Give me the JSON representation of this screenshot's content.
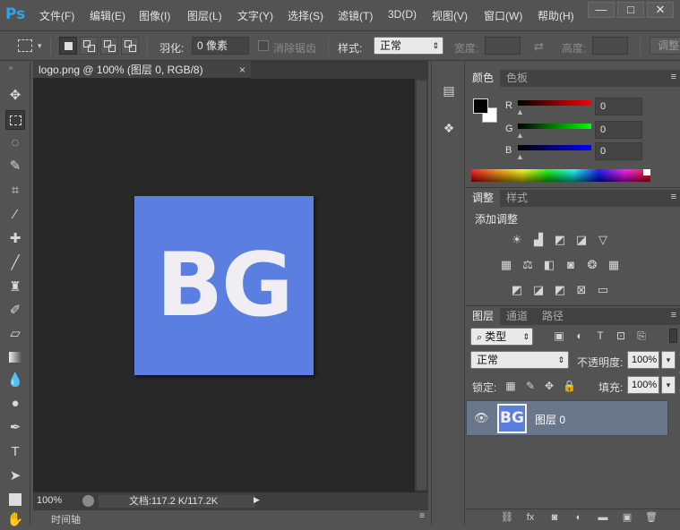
{
  "app": {
    "logo": "Ps"
  },
  "menu": [
    "文件(F)",
    "编辑(E)",
    "图像(I)",
    "图层(L)",
    "文字(Y)",
    "选择(S)",
    "滤镜(T)",
    "3D(D)",
    "视图(V)",
    "窗口(W)",
    "帮助(H)"
  ],
  "window_controls": {
    "minimize": "—",
    "maximize": "□",
    "close": "✕"
  },
  "options": {
    "feather_label": "羽化:",
    "feather_value": "0 像素",
    "antialias_label": "消除锯齿",
    "style_label": "样式:",
    "style_value": "正常",
    "width_label": "宽度:",
    "height_label": "高度:",
    "adjust_button": "调整"
  },
  "document": {
    "tab_title": "logo.png @ 100% (图层 0, RGB/8)",
    "close": "×",
    "artboard_text": "BG",
    "artboard_color": "#5b7fe0",
    "zoom": "100%",
    "doc_size": "文档:117.2 K/117.2K"
  },
  "timeline": {
    "label": "时间轴"
  },
  "color_panel": {
    "tabs": [
      "颜色",
      "色板"
    ],
    "channels": [
      {
        "label": "R",
        "value": "0",
        "color": "#ff0000"
      },
      {
        "label": "G",
        "value": "0",
        "color": "#00ff00"
      },
      {
        "label": "B",
        "value": "0",
        "color": "#0000ff"
      }
    ]
  },
  "adjust_panel": {
    "tabs": [
      "调整",
      "样式"
    ],
    "title": "添加调整",
    "row1": [
      "brightness-icon",
      "levels-icon",
      "curves-icon",
      "exposure-icon",
      "vibrance-icon"
    ],
    "row2": [
      "hue-saturation-icon",
      "color-balance-icon",
      "black-white-icon",
      "photo-filter-icon",
      "channel-mixer-icon",
      "color-lookup-icon"
    ],
    "row3": [
      "invert-icon",
      "posterize-icon",
      "threshold-icon",
      "selective-color-icon",
      "gradient-map-icon"
    ]
  },
  "layers_panel": {
    "tabs": [
      "图层",
      "通道",
      "路径"
    ],
    "filter_kind": "类型",
    "blend_mode": "正常",
    "opacity_label": "不透明度:",
    "opacity_value": "100%",
    "lock_label": "锁定:",
    "fill_label": "填充:",
    "fill_value": "100%",
    "layers": [
      {
        "name": "图层 0",
        "thumb_text": "BG"
      }
    ]
  }
}
